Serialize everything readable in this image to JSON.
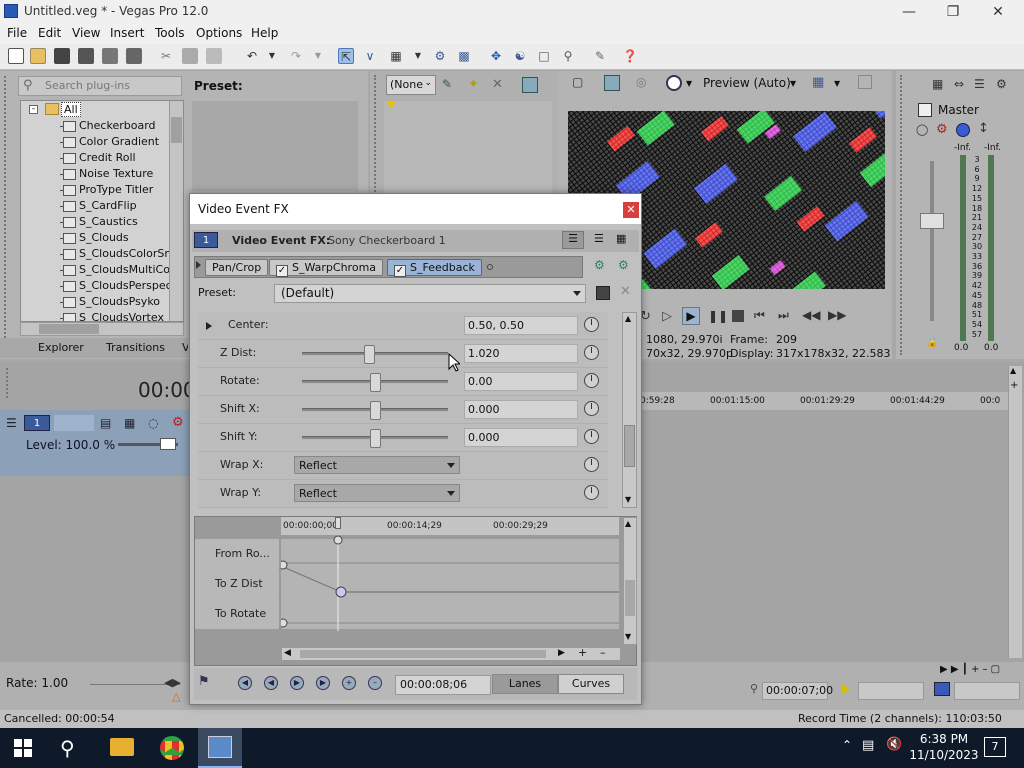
{
  "window": {
    "title": "Untitled.veg * - Vegas Pro 12.0"
  },
  "menu": [
    "File",
    "Edit",
    "View",
    "Insert",
    "Tools",
    "Options",
    "Help"
  ],
  "plugins": {
    "search_placeholder": "Search plug-ins",
    "root": "All",
    "items": [
      "Checkerboard",
      "Color Gradient",
      "Credit Roll",
      "Noise Texture",
      "ProType Titler",
      "S_CardFlip",
      "S_Caustics",
      "S_Clouds",
      "S_CloudsColorSmo",
      "S_CloudsMultiColo",
      "S_CloudsPerspect",
      "S_CloudsPsyko",
      "S_CloudsVortex"
    ],
    "tabs": [
      "Explorer",
      "Transitions",
      "V"
    ]
  },
  "preset_panel": {
    "label": "Preset:"
  },
  "mid_panel": {
    "none_label": "(None"
  },
  "preview": {
    "mode": "Preview (Auto)",
    "info_left1": "1080, 29.970i",
    "info_left2": "70x32, 29.970p",
    "frame_label": "Frame:",
    "frame_value": "209",
    "display_label": "Display:",
    "display_value": "317x178x32, 22.583"
  },
  "master": {
    "label": "Master",
    "inf_left": "-Inf.",
    "inf_right": "-Inf.",
    "scale": [
      "3",
      "6",
      "9",
      "12",
      "15",
      "18",
      "21",
      "24",
      "27",
      "30",
      "33",
      "36",
      "39",
      "42",
      "45",
      "48",
      "51",
      "54",
      "57"
    ],
    "val_left": "0.0",
    "val_right": "0.0"
  },
  "timeline": {
    "time_display": "00:00",
    "level": "Level: 100.0 %",
    "ruler": [
      "0:59:28",
      "00:01:15:00",
      "00:01:29:29",
      "00:01:44:29",
      "00:0"
    ],
    "rate": "Rate: 1.00",
    "cursor_time": "00:00:07;00"
  },
  "status": {
    "left": "Cancelled: 00:00:54",
    "right": "Record Time (2 channels): 110:03:50"
  },
  "taskbar": {
    "time": "6:38 PM",
    "date": "11/10/2023",
    "notif_count": "7"
  },
  "dialog": {
    "title": "Video Event FX",
    "header_label": "Video Event FX:",
    "header_value": "Sony Checkerboard 1",
    "badge": "1",
    "chain": [
      "Pan/Crop",
      "S_WarpChroma",
      "S_Feedback"
    ],
    "preset_label": "Preset:",
    "preset_value": "(Default)",
    "params": [
      {
        "label": "Center:",
        "value": "0.50, 0.50"
      },
      {
        "label": "Z Dist:",
        "value": "1.020",
        "slider": 0.46
      },
      {
        "label": "Rotate:",
        "value": "0.00",
        "slider": 0.5
      },
      {
        "label": "Shift X:",
        "value": "0.000",
        "slider": 0.5
      },
      {
        "label": "Shift Y:",
        "value": "0.000",
        "slider": 0.5
      },
      {
        "label": "Wrap X:",
        "value": "Reflect"
      },
      {
        "label": "Wrap Y:",
        "value": "Reflect"
      }
    ],
    "kf_ruler": [
      "00:00:00;00",
      "00:00:14;29",
      "00:00:29;29"
    ],
    "kf_lanes": [
      "From Ro...",
      "To Z Dist",
      "To Rotate"
    ],
    "kf_time": "00:00:08;06",
    "lanes_label": "Lanes",
    "curves_label": "Curves"
  }
}
